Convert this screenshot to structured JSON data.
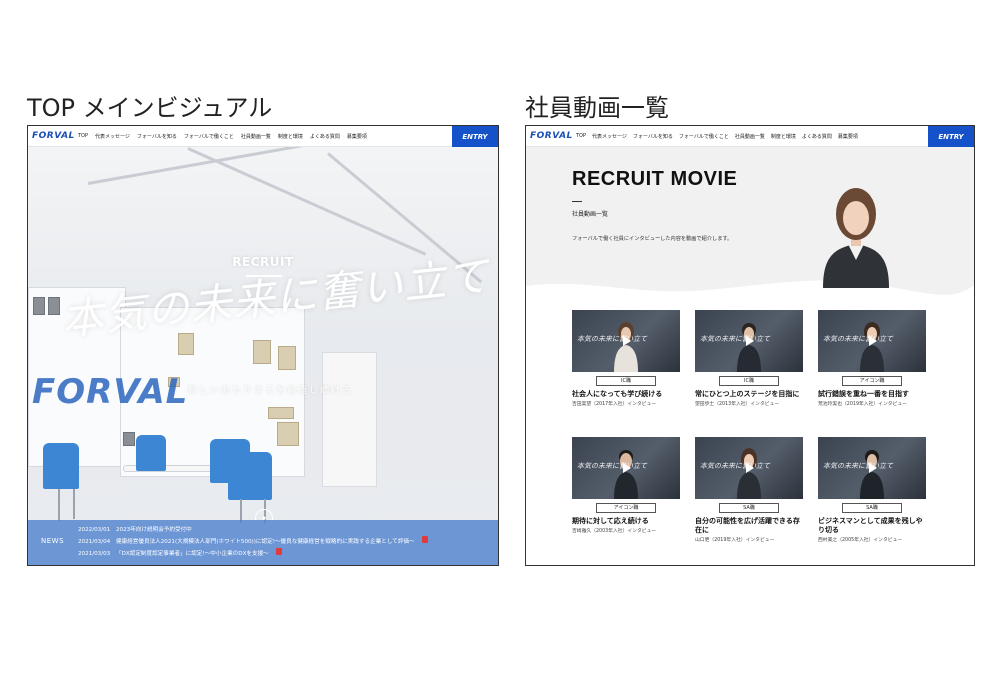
{
  "labels": {
    "top_visual": "TOP メインビジュアル",
    "movie_list": "社員動画一覧"
  },
  "nav": {
    "logo": "FORVAL",
    "items": [
      "TOP",
      "代表メッセージ",
      "フォーバルを知る",
      "フォーバルで働くこと",
      "社員動画一覧",
      "制度と環境",
      "よくある質問",
      "募集要項"
    ],
    "entry": "ENTRY"
  },
  "hero": {
    "recruit": "RECRUIT",
    "catch": "本気の未来に奮い立て",
    "sub_catch": "新しいあたりまえを創造し続ける",
    "sign": "FORVAL",
    "colors": {
      "accent": "#1552c9",
      "news_bg": "#5282d0",
      "chair": "#3d86d4"
    }
  },
  "news": {
    "label": "NEWS",
    "items": [
      {
        "date": "2022/03/01",
        "text": "2023年向け説明会予約受付中"
      },
      {
        "date": "2021/03/04",
        "text": "健康経営優良法人2021(大規模法人部門(ホワイト500))に認定!～優良な健康経営を戦略的に実践する企業として評価～"
      },
      {
        "date": "2021/03/03",
        "text": "「DX認定制度認定事業者」に認定!～中小企業のDXを支援～"
      }
    ]
  },
  "movie": {
    "title": "RECRUIT MOVIE",
    "subtitle": "社員動画一覧",
    "description": "フォーバルで働く社員にインタビューした内容を動画で紹介します。",
    "cards": [
      {
        "tag": "IC職",
        "title": "社会人になっても学び続ける",
        "meta": "吉田実望（2017年入社）インタビュー"
      },
      {
        "tag": "IC職",
        "title": "常にひとつ上のステージを目指に",
        "meta": "望田歩士（2013年入社）インタビュー"
      },
      {
        "tag": "アイコン職",
        "title": "試行錯誤を重ね一番を目指す",
        "meta": "荒池玲実也（2019年入社）インタビュー"
      },
      {
        "tag": "アイコン職",
        "title": "期待に対して応え続ける",
        "meta": "吉崎雅久（2003年入社）インタビュー"
      },
      {
        "tag": "SA職",
        "title": "自分の可能性を広げ活躍できる存在に",
        "meta": "山口更（2019年入社）インタビュー"
      },
      {
        "tag": "SA職",
        "title": "ビジネスマンとして成果を残しやり切る",
        "meta": "西村美之（2005年入社）インタビュー"
      }
    ],
    "thumb_script": "本気の未来に奮い立て"
  }
}
